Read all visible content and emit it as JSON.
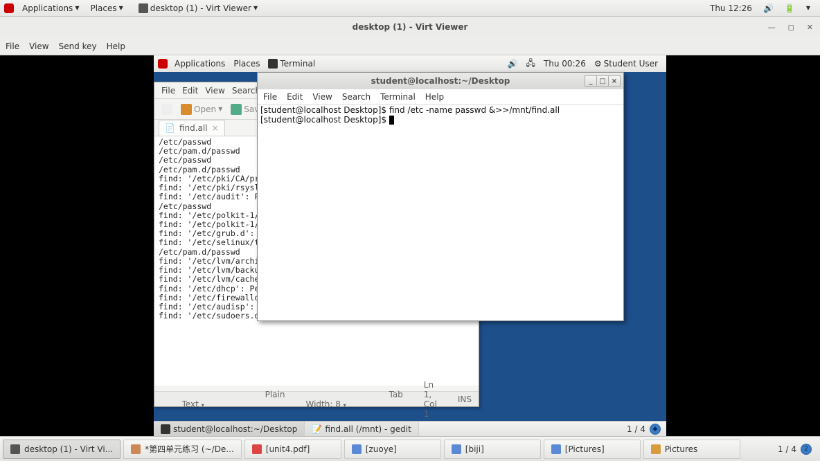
{
  "outer_panel": {
    "applications": "Applications",
    "places": "Places",
    "active_window": "desktop (1) - Virt Viewer",
    "clock": "Thu 12:26"
  },
  "virt_viewer": {
    "title": "desktop (1) - Virt Viewer",
    "menu": {
      "file": "File",
      "view": "View",
      "sendkey": "Send key",
      "help": "Help"
    }
  },
  "inner_panel": {
    "applications": "Applications",
    "places": "Places",
    "task_title": "Terminal",
    "clock": "Thu 00:26",
    "user": "Student User"
  },
  "gedit": {
    "menu": {
      "file": "File",
      "edit": "Edit",
      "view": "View",
      "search": "Search"
    },
    "toolbar": {
      "open": "Open",
      "save": "Sav"
    },
    "tab": "find.all",
    "content": "/etc/passwd\n/etc/pam.d/passwd\n/etc/passwd\n/etc/pam.d/passwd\nfind: '/etc/pki/CA/priv\nfind: '/etc/pki/rsyslog\nfind: '/etc/audit': Pe\n/etc/passwd\nfind: '/etc/polkit-1/ru\nfind: '/etc/polkit-1/lo\nfind: '/etc/grub.d': Pe\nfind: '/etc/selinux/tar\n/etc/pam.d/passwd\nfind: '/etc/lvm/archive\nfind: '/etc/lvm/backup'\nfind: '/etc/lvm/cache':\nfind: '/etc/dhcp': Perm\nfind: '/etc/firewalld':\nfind: '/etc/audisp': Permission denied\nfind: '/etc/sudoers.d': Permission denied",
    "status": {
      "lang": "Plain Text",
      "tabwidth": "Tab Width: 8",
      "pos": "Ln 1, Col 1",
      "ins": "INS"
    }
  },
  "terminal": {
    "title": "student@localhost:~/Desktop",
    "menu": {
      "file": "File",
      "edit": "Edit",
      "view": "View",
      "search": "Search",
      "terminal": "Terminal",
      "help": "Help"
    },
    "line1_prompt": "[student@localhost Desktop]$ ",
    "line1_cmd": "find /etc -name passwd &>>/mnt/find.all",
    "line2_prompt": "[student@localhost Desktop]$ "
  },
  "inner_taskbar": {
    "task1": "student@localhost:~/Desktop",
    "task2": "find.all (/mnt) - gedit",
    "workspace": "1 / 4"
  },
  "outer_taskbar": {
    "items": [
      "desktop (1) - Virt Vi...",
      "*第四单元练习 (~/De...",
      "[unit4.pdf]",
      "[zuoye]",
      "[biji]",
      "[Pictures]",
      "Pictures"
    ],
    "workspace": "1 / 4"
  }
}
